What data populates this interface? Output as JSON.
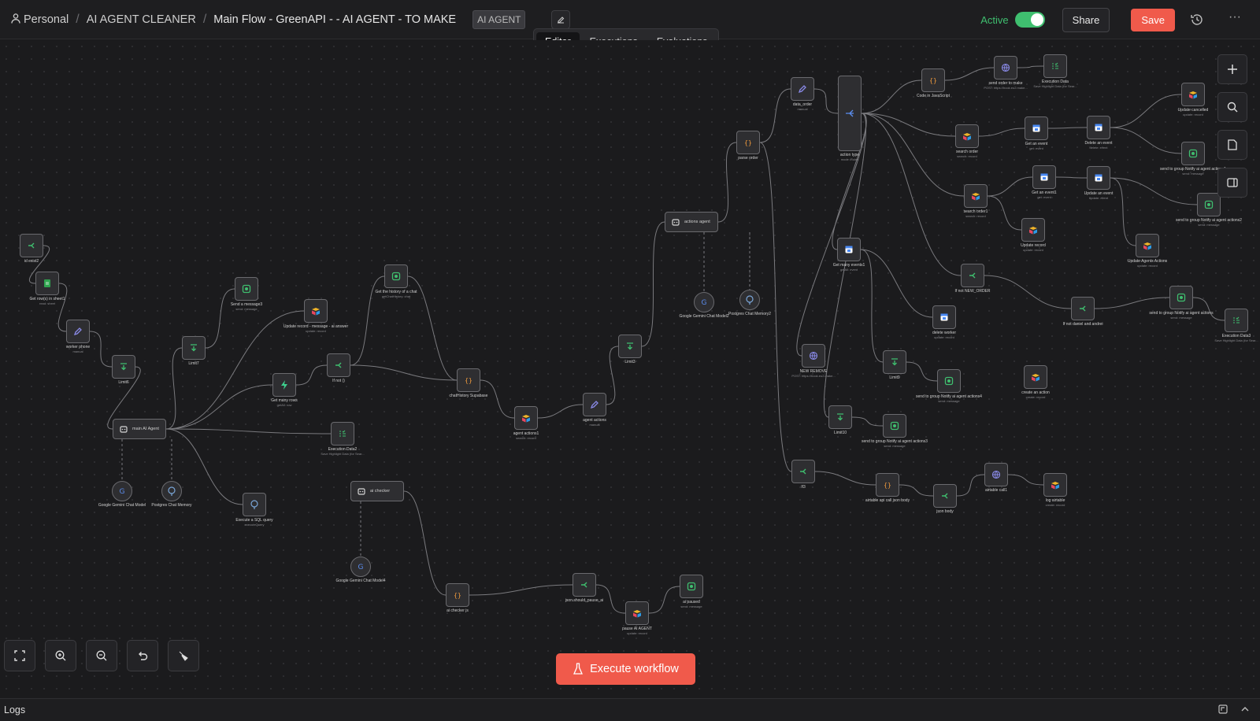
{
  "breadcrumb": {
    "personal": "Personal",
    "project": "AI AGENT CLEANER",
    "workflow": "Main Flow - GreenAPI - - AI AGENT - TO MAKE",
    "tag": "AI AGENT"
  },
  "header": {
    "active_label": "Active",
    "active": true,
    "share_label": "Share",
    "save_label": "Save"
  },
  "tabs": [
    {
      "label": "Editor",
      "active": true
    },
    {
      "label": "Executions",
      "active": false
    },
    {
      "label": "Evaluations",
      "active": false
    }
  ],
  "execute_label": "Execute workflow",
  "logs_label": "Logs",
  "colors": {
    "accent": "#f05a4b",
    "active_green": "#3fbf6f",
    "canvas_bg": "#1b1b1d"
  },
  "nodes": [
    {
      "id": "n1",
      "label": "id exist2",
      "sub": "",
      "icon": "if"
    },
    {
      "id": "n2",
      "label": "Get row(s) in sheet1",
      "sub": "read: sheet",
      "icon": "sheets"
    },
    {
      "id": "n3",
      "label": "worker phone",
      "sub": "manual",
      "icon": "edit"
    },
    {
      "id": "n4",
      "label": "Limit6",
      "sub": "",
      "icon": "limit"
    },
    {
      "id": "n5",
      "label": "main AI Agent",
      "sub": "",
      "icon": "agent"
    },
    {
      "id": "n6",
      "label": "Google Gemini Chat Model",
      "sub": "",
      "icon": "gemini"
    },
    {
      "id": "n7",
      "label": "Postgres Chat Memory",
      "sub": "",
      "icon": "postgres"
    },
    {
      "id": "n8",
      "label": "Limit7",
      "sub": "",
      "icon": "limit"
    },
    {
      "id": "n9",
      "label": "Send a message3",
      "sub": "send: message",
      "icon": "greenapi"
    },
    {
      "id": "n10",
      "label": "Update record - message - ai answer",
      "sub": "update: record",
      "icon": "airtable"
    },
    {
      "id": "n11",
      "label": "Get many rows",
      "sub": "getAll: row",
      "icon": "supabase"
    },
    {
      "id": "n12",
      "label": "If not ()",
      "sub": "",
      "icon": "if"
    },
    {
      "id": "n13",
      "label": "Get the history of a chat",
      "sub": "getChatHistory: chat",
      "icon": "greenapi"
    },
    {
      "id": "n14",
      "label": "chatHistory Supabase",
      "sub": "",
      "icon": "code"
    },
    {
      "id": "n15",
      "label": "Execution Data2",
      "sub": "Save Highlight Data (for Sear...",
      "icon": "execdata"
    },
    {
      "id": "n16",
      "label": "Execute a SQL query",
      "sub": "executeQuery",
      "icon": "postgres"
    },
    {
      "id": "n17",
      "label": "agent actions1",
      "sub": "search: record",
      "icon": "airtable"
    },
    {
      "id": "n18",
      "label": "agent actions",
      "sub": "manual",
      "icon": "edit"
    },
    {
      "id": "n19",
      "label": "Limit3",
      "sub": "",
      "icon": "limit"
    },
    {
      "id": "n20",
      "label": "actions agent",
      "sub": "",
      "icon": "agent"
    },
    {
      "id": "n21",
      "label": "Google Gemini Chat Model2",
      "sub": "",
      "icon": "gemini"
    },
    {
      "id": "n22",
      "label": "Postgres Chat Memory2",
      "sub": "",
      "icon": "postgres"
    },
    {
      "id": "n23",
      "label": "ai checker",
      "sub": "",
      "icon": "agent"
    },
    {
      "id": "n24",
      "label": "Google Gemini Chat Model4",
      "sub": "",
      "icon": "gemini"
    },
    {
      "id": "n25",
      "label": "ai checker js",
      "sub": "",
      "icon": "code"
    },
    {
      "id": "n26",
      "label": "json.should_pause_ai",
      "sub": "",
      "icon": "if"
    },
    {
      "id": "n27",
      "label": "pause AI AGENT",
      "sub": "update: record",
      "icon": "airtable"
    },
    {
      "id": "n28",
      "label": "ai paused",
      "sub": "send: message",
      "icon": "greenapi"
    },
    {
      "id": "n29",
      "label": "parse order",
      "sub": "",
      "icon": "code"
    },
    {
      "id": "n30",
      "label": "data_order",
      "sub": "manual",
      "icon": "edit"
    },
    {
      "id": "n31",
      "label": "action type",
      "sub": "mode: Rules",
      "icon": "switch"
    },
    {
      "id": "n32",
      "label": "Code in JavaScript",
      "sub": "",
      "icon": "code"
    },
    {
      "id": "n33",
      "label": "send order to make",
      "sub": "POST: https://hook.eu2.make...",
      "icon": "http"
    },
    {
      "id": "n34",
      "label": "Execution Data",
      "sub": "Save Highlight Data (for Sear...",
      "icon": "execdata"
    },
    {
      "id": "n35",
      "label": "search order",
      "sub": "search: record",
      "icon": "airtable"
    },
    {
      "id": "n36",
      "label": "Get an event",
      "sub": "get: event",
      "icon": "gcal"
    },
    {
      "id": "n37",
      "label": "Delete an event",
      "sub": "delete: event",
      "icon": "gcal"
    },
    {
      "id": "n38",
      "label": "Update cancelled",
      "sub": "update: record",
      "icon": "airtable"
    },
    {
      "id": "n39",
      "label": "send to group Notify ai agent actions1",
      "sub": "send: message",
      "icon": "greenapi"
    },
    {
      "id": "n40",
      "label": "search order1",
      "sub": "search: record",
      "icon": "airtable"
    },
    {
      "id": "n41",
      "label": "Get an event1",
      "sub": "get: event",
      "icon": "gcal"
    },
    {
      "id": "n42",
      "label": "Update an event",
      "sub": "update: event",
      "icon": "gcal"
    },
    {
      "id": "n43",
      "label": "send to group Notify ai agent actions2",
      "sub": "send: message",
      "icon": "greenapi"
    },
    {
      "id": "n44",
      "label": "Update record",
      "sub": "update: record",
      "icon": "airtable"
    },
    {
      "id": "n45",
      "label": "Update Agents Actions",
      "sub": "update: record",
      "icon": "airtable"
    },
    {
      "id": "n46",
      "label": "Get many events1",
      "sub": "getAll: event",
      "icon": "gcal"
    },
    {
      "id": "n47",
      "label": "If not NEW_ORDER",
      "sub": "",
      "icon": "if"
    },
    {
      "id": "n48",
      "label": "If not daniel and andrei",
      "sub": "",
      "icon": "if"
    },
    {
      "id": "n49",
      "label": "send to group Notify ai agent actions",
      "sub": "send: message",
      "icon": "greenapi"
    },
    {
      "id": "n50",
      "label": "Execution Data3",
      "sub": "Save Highlight Data (for Sear...",
      "icon": "execdata"
    },
    {
      "id": "n51",
      "label": "delete worker",
      "sub": "update: record",
      "icon": "gcal"
    },
    {
      "id": "n52",
      "label": "NEW REMOVE",
      "sub": "POST: https://hook.eu2.make...",
      "icon": "http"
    },
    {
      "id": "n53",
      "label": "Limit9",
      "sub": "",
      "icon": "limit"
    },
    {
      "id": "n54",
      "label": "send to group Notify ai agent actions4",
      "sub": "send: message",
      "icon": "greenapi"
    },
    {
      "id": "n55",
      "label": "create an action",
      "sub": "create: record",
      "icon": "airtable"
    },
    {
      "id": "n56",
      "label": "Limit10",
      "sub": "",
      "icon": "limit"
    },
    {
      "id": "n57",
      "label": "send to group Notify ai agent actions3",
      "sub": "send: message",
      "icon": "greenapi"
    },
    {
      "id": "n58",
      "label": "If3",
      "sub": "",
      "icon": "if"
    },
    {
      "id": "n59",
      "label": "airtable api call json body",
      "sub": "",
      "icon": "code"
    },
    {
      "id": "n60",
      "label": "json body",
      "sub": "",
      "icon": "if"
    },
    {
      "id": "n61",
      "label": "airtable call1",
      "sub": "",
      "icon": "http"
    },
    {
      "id": "n62",
      "label": "log airtable",
      "sub": "create: record",
      "icon": "airtable"
    }
  ]
}
